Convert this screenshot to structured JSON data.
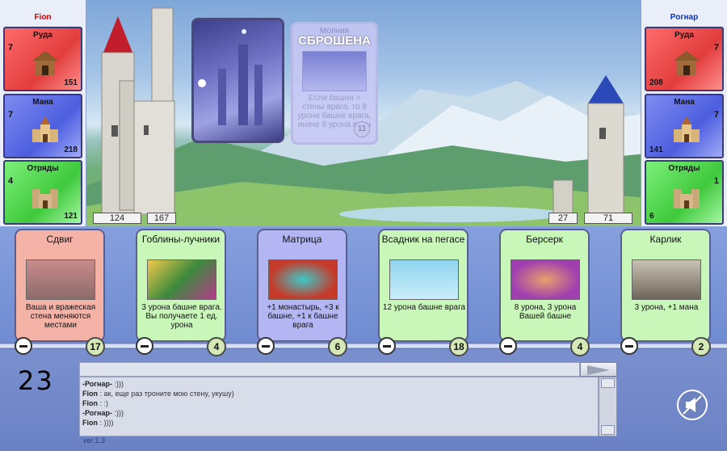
{
  "players": {
    "left": {
      "name": "Fion",
      "tower": "124",
      "wall": "167",
      "resources": [
        {
          "label": "Руда",
          "production": "7",
          "amount": "151",
          "icon": "mine-icon"
        },
        {
          "label": "Мана",
          "production": "7",
          "amount": "218",
          "icon": "temple-icon"
        },
        {
          "label": "Отряды",
          "production": "4",
          "amount": "121",
          "icon": "barracks-icon"
        }
      ]
    },
    "right": {
      "name": "Рогнар",
      "wall": "27",
      "tower": "71",
      "resources": [
        {
          "label": "Руда",
          "production": "7",
          "amount": "208",
          "icon": "mine-icon"
        },
        {
          "label": "Мана",
          "production": "7",
          "amount": "141",
          "icon": "temple-icon"
        },
        {
          "label": "Отряды",
          "production": "1",
          "amount": "6",
          "icon": "barracks-icon"
        }
      ]
    }
  },
  "discarded_card": {
    "title": "Молния",
    "stamp": "СБРОШЕНА",
    "description": "Если башня > стены врага, то 8 урона башне врага, иначе 8 урона всем",
    "cost": "11"
  },
  "hand": [
    {
      "title": "Сдвиг",
      "description": "Ваша и вражеская стена меняются местами",
      "cost": "17",
      "color": "red"
    },
    {
      "title": "Гоблины-лучники",
      "description": "3 урона башне врага. Вы получаете 1 ед. урона",
      "cost": "4",
      "color": "green"
    },
    {
      "title": "Матрица",
      "description": "+1 монастырь, +3 к башне, +1 к башне врага",
      "cost": "6",
      "color": "blue"
    },
    {
      "title": "Всадник на пегасе",
      "description": "12 урона башне врага",
      "cost": "18",
      "color": "green"
    },
    {
      "title": "Берсерк",
      "description": "8 урона, 3 урона Вашей башне",
      "cost": "4",
      "color": "green"
    },
    {
      "title": "Карлик",
      "description": "3 урона, +1 мана",
      "cost": "2",
      "color": "green"
    }
  ],
  "timer": "23",
  "chat": {
    "input_value": "",
    "messages": [
      {
        "author": "-Рогнар-",
        "text": " :)))"
      },
      {
        "author": "Fion",
        "text": " : ак, еще раз троните мою стену, укушу)"
      },
      {
        "author": "Fion",
        "text": " : :)"
      },
      {
        "author": "-Рогнар-",
        "text": " :)))"
      },
      {
        "author": "Fion",
        "text": " : ))))"
      }
    ]
  },
  "version": "ver.1.3",
  "colors": {
    "ore": "#e23d3d",
    "mana": "#4d5ee0",
    "troops": "#3fc93c",
    "left_name": "#cc0000",
    "right_name": "#0033cc"
  }
}
